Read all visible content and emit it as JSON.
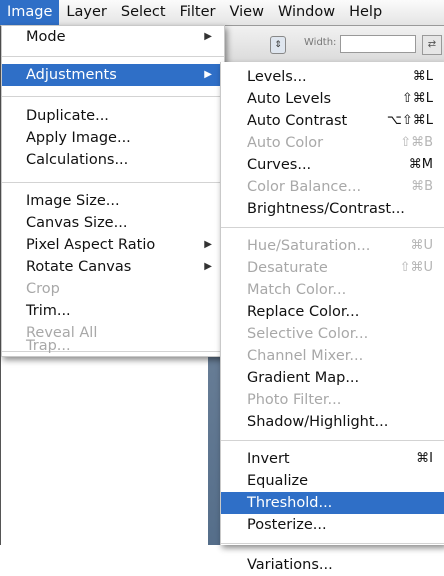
{
  "menubar": {
    "items": [
      "Image",
      "Layer",
      "Select",
      "Filter",
      "View",
      "Window",
      "Help"
    ]
  },
  "options_bar": {
    "width_label": "Width:"
  },
  "image_menu": {
    "items": [
      {
        "label": "Mode",
        "submenu": true,
        "enabled": true
      },
      {
        "label": "Adjustments",
        "submenu": true,
        "enabled": true,
        "active": true
      },
      {
        "label": "Duplicate...",
        "enabled": true
      },
      {
        "label": "Apply Image...",
        "enabled": true
      },
      {
        "label": "Calculations...",
        "enabled": true
      },
      {
        "label": "Image Size...",
        "enabled": true
      },
      {
        "label": "Canvas Size...",
        "enabled": true
      },
      {
        "label": "Pixel Aspect Ratio",
        "submenu": true,
        "enabled": true
      },
      {
        "label": "Rotate Canvas",
        "submenu": true,
        "enabled": true
      },
      {
        "label": "Crop",
        "enabled": false
      },
      {
        "label": "Trim...",
        "enabled": true
      },
      {
        "label": "Reveal All",
        "enabled": false
      },
      {
        "label": "Trap...",
        "enabled": false
      }
    ]
  },
  "adjustments_menu": {
    "items": [
      {
        "label": "Levels...",
        "shortcut": "⌘L",
        "enabled": true
      },
      {
        "label": "Auto Levels",
        "shortcut": "⇧⌘L",
        "enabled": true
      },
      {
        "label": "Auto Contrast",
        "shortcut": "⌥⇧⌘L",
        "enabled": true
      },
      {
        "label": "Auto Color",
        "shortcut": "⇧⌘B",
        "enabled": false
      },
      {
        "label": "Curves...",
        "shortcut": "⌘M",
        "enabled": true
      },
      {
        "label": "Color Balance...",
        "shortcut": "⌘B",
        "enabled": false
      },
      {
        "label": "Brightness/Contrast...",
        "shortcut": "",
        "enabled": true
      },
      {
        "label": "Hue/Saturation...",
        "shortcut": "⌘U",
        "enabled": false
      },
      {
        "label": "Desaturate",
        "shortcut": "⇧⌘U",
        "enabled": false
      },
      {
        "label": "Match Color...",
        "shortcut": "",
        "enabled": false
      },
      {
        "label": "Replace Color...",
        "shortcut": "",
        "enabled": true
      },
      {
        "label": "Selective Color...",
        "shortcut": "",
        "enabled": false
      },
      {
        "label": "Channel Mixer...",
        "shortcut": "",
        "enabled": false
      },
      {
        "label": "Gradient Map...",
        "shortcut": "",
        "enabled": true
      },
      {
        "label": "Photo Filter...",
        "shortcut": "",
        "enabled": false
      },
      {
        "label": "Shadow/Highlight...",
        "shortcut": "",
        "enabled": true
      },
      {
        "label": "Invert",
        "shortcut": "⌘I",
        "enabled": true
      },
      {
        "label": "Equalize",
        "shortcut": "",
        "enabled": true
      },
      {
        "label": "Threshold...",
        "shortcut": "",
        "enabled": true,
        "active": true
      },
      {
        "label": "Posterize...",
        "shortcut": "",
        "enabled": true
      },
      {
        "label": "Variations...",
        "shortcut": "",
        "enabled": true
      }
    ]
  },
  "colors": {
    "highlight": "#2f6fc7",
    "disabled_text": "#a8a8a8"
  }
}
